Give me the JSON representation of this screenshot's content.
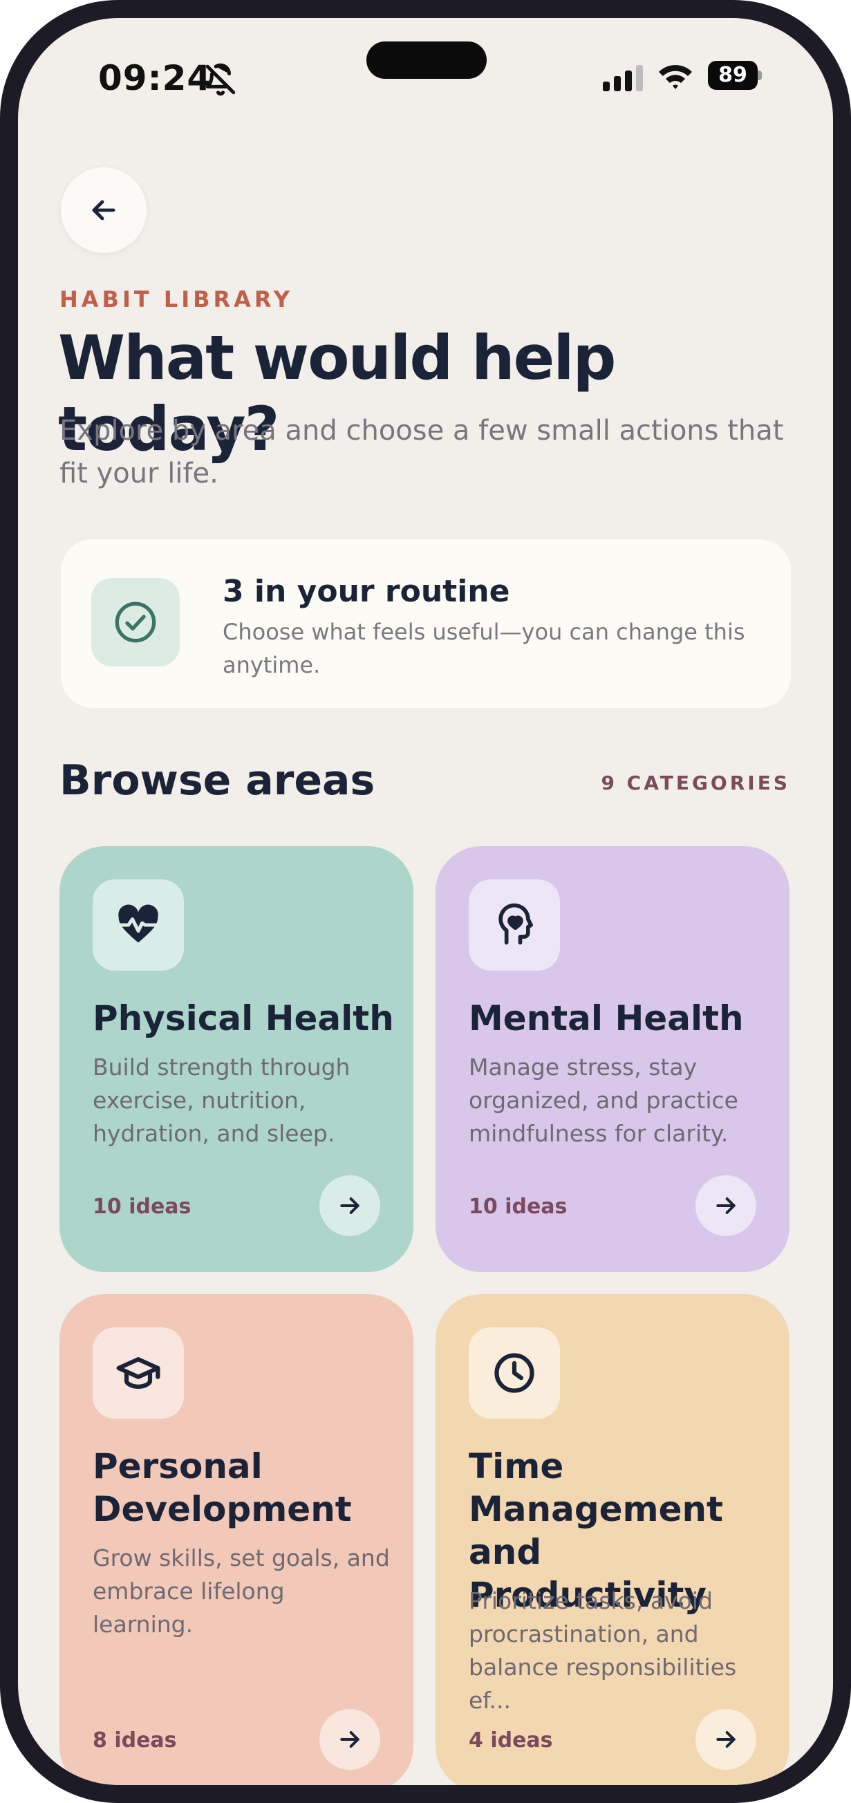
{
  "status_bar": {
    "time": "09:24",
    "battery": "89",
    "icons": [
      "bell-off-icon",
      "cellular-signal-icon",
      "wifi-icon",
      "battery-icon"
    ]
  },
  "header": {
    "back_icon": "arrow-left-icon",
    "eyebrow": "HABIT LIBRARY",
    "title": "What would help today?",
    "subtitle": "Explore by area and choose a few small actions that fit your life."
  },
  "routine": {
    "icon": "check-circle-icon",
    "title": "3 in your routine",
    "description": "Choose what feels useful—you can change this anytime."
  },
  "browse": {
    "title": "Browse areas",
    "count": "9 CATEGORIES"
  },
  "categories": [
    {
      "title": "Physical Health",
      "description": "Build strength through exercise, nutrition, hydration, and sleep.",
      "ideas": "10 ideas",
      "icon": "heartbeat-icon",
      "color": "#aed5cb"
    },
    {
      "title": "Mental Health",
      "description": "Manage stress, stay organized, and practice mindfulness for clarity.",
      "ideas": "10 ideas",
      "icon": "head-heart-icon",
      "color": "#d8c7ea"
    },
    {
      "title": "Personal Development",
      "description": "Grow skills, set goals, and embrace lifelong learning.",
      "ideas": "8 ideas",
      "icon": "graduation-cap-icon",
      "color": "#f2c8b8"
    },
    {
      "title": "Time Management and Productivity",
      "description": "Prioritize tasks, avoid procrastination, and balance responsibilities ef...",
      "ideas": "4 ideas",
      "icon": "clock-icon",
      "color": "#f3d7b0"
    }
  ],
  "colors": {
    "background": "#f2eee9",
    "ink": "#1b2338",
    "accent_eyebrow": "#c0604a",
    "ideas_text": "#7b4a5c"
  }
}
